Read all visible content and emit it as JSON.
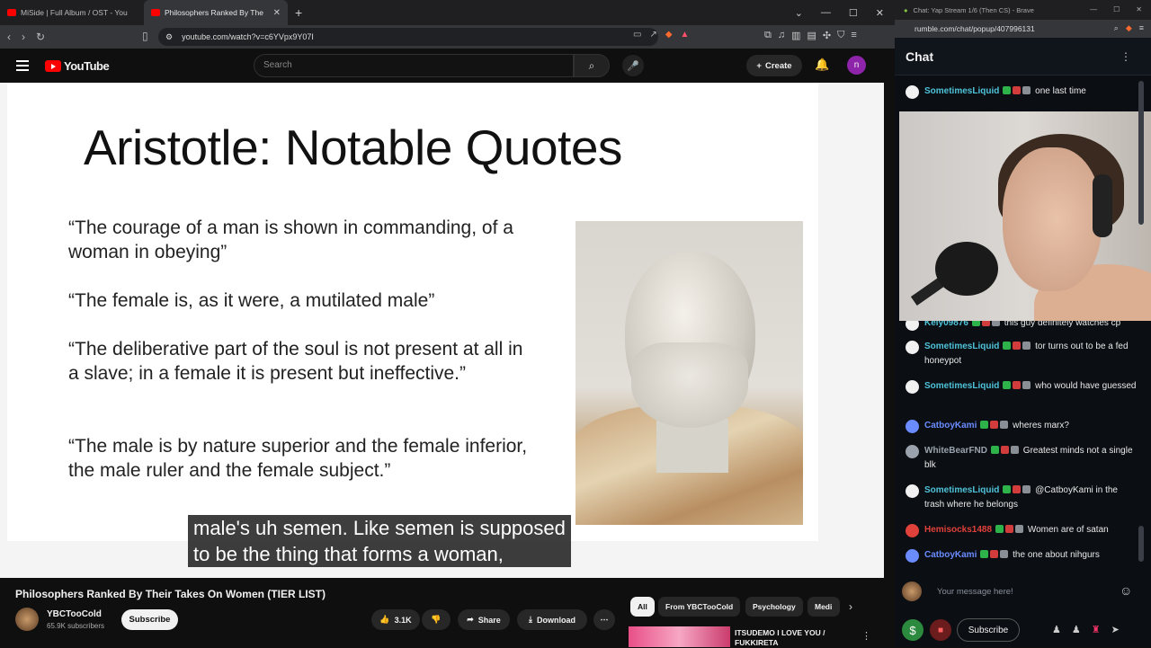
{
  "browser": {
    "tabs": [
      {
        "title": "MiSide | Full Album / OST - You"
      },
      {
        "title": "Philosophers Ranked By The"
      }
    ],
    "url": "youtube.com/watch?v=c6YVpx9Y07I"
  },
  "youtube": {
    "logo": "YouTube",
    "search_placeholder": "Search",
    "create_label": "Create",
    "avatar_letter": "n"
  },
  "slide": {
    "title": "Aristotle: Notable Quotes",
    "quotes": [
      "“The courage of a man is shown in commanding, of a woman in obeying”",
      "“The female is, as it were, a mutilated male”",
      "“The deliberative part of the soul is not present at all in a slave; in a female it is present but ineffective.”",
      "“The male is by nature superior and the female inferior, the male ruler and the female subject.”"
    ]
  },
  "captions": {
    "line1": "male's uh semen. Like semen is supposed",
    "line2": "to be the thing that forms a woman,"
  },
  "video": {
    "title": "Philosophers Ranked By Their Takes On Women (TIER LIST)",
    "channel": "YBCTooCold",
    "subscribers": "65.9K subscribers",
    "subscribe_label": "Subscribe",
    "likes": "3.1K",
    "share_label": "Share",
    "download_label": "Download"
  },
  "chips": [
    "All",
    "From YBCTooCold",
    "Psychology",
    "Medi"
  ],
  "related": {
    "title": "ITSUDEMO I LOVE YOU / FUKKIRETA"
  },
  "chat_window": {
    "tab_title": "Chat: Yap Stream 1/6 (Then CS) - Brave",
    "url": "rumble.com/chat/popup/407996131",
    "header": "Chat",
    "input_placeholder": "Your message here!",
    "subscribe_label": "Subscribe"
  },
  "chat_messages": [
    {
      "user": "SometimesLiquid",
      "text": "one last time",
      "color": "#4fc3d9"
    },
    {
      "user": "Kely09876",
      "text": "this guy definitely watches cp",
      "color": "#4fc3d9"
    },
    {
      "user": "SometimesLiquid",
      "text": "tor turns out to be a fed honeypot",
      "color": "#4fc3d9"
    },
    {
      "user": "SometimesLiquid",
      "text": "who would have guessed",
      "color": "#4fc3d9"
    },
    {
      "user": "CatboyKami",
      "text": "wheres marx?",
      "color": "#6a8cff"
    },
    {
      "user": "WhiteBearFND",
      "text": "Greatest minds not a single blk",
      "color": "#9aa3ad"
    },
    {
      "user": "SometimesLiquid",
      "text": "@CatboyKami in the trash where he belongs",
      "color": "#4fc3d9"
    },
    {
      "user": "Hemisocks1488",
      "text": "Women are of satan",
      "color": "#e0413b"
    },
    {
      "user": "CatboyKami",
      "text": "the one about nihgurs",
      "color": "#6a8cff"
    }
  ]
}
